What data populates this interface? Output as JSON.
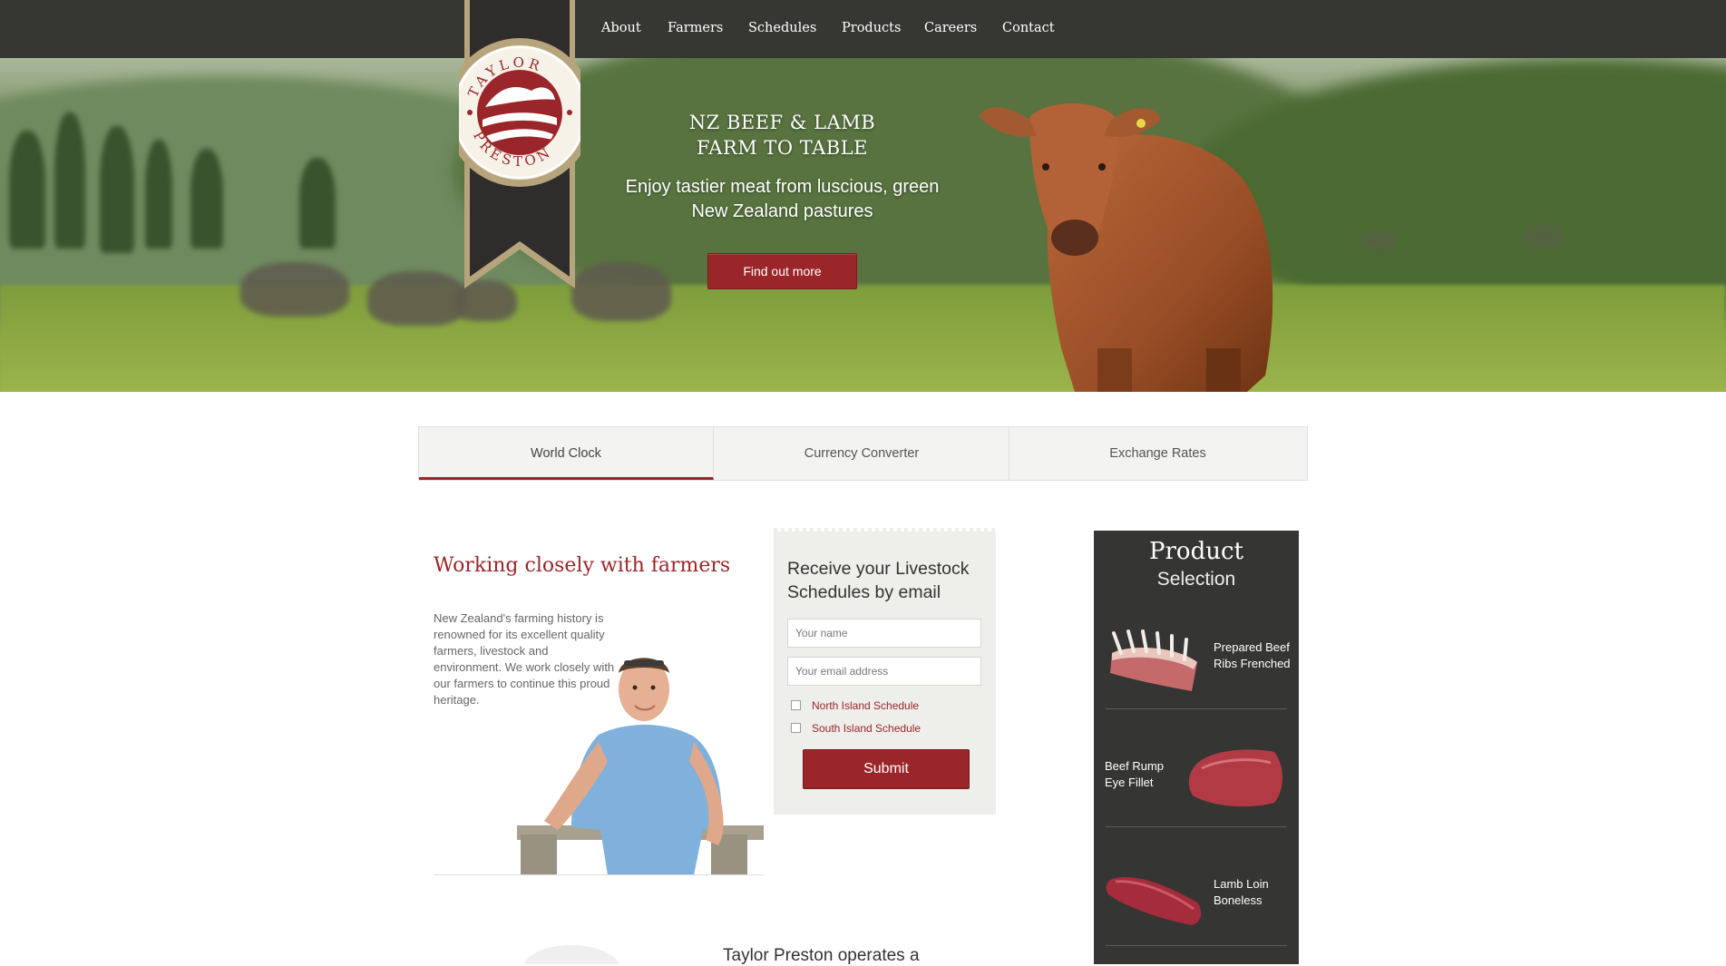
{
  "nav": {
    "items": [
      "About",
      "Farmers",
      "Schedules",
      "Products",
      "Careers",
      "Contact"
    ]
  },
  "logo": {
    "brand_text": "TAYLOR PRESTON"
  },
  "hero": {
    "title_line1": "NZ BEEF & LAMB",
    "title_line2": "FARM TO TABLE",
    "subtitle_line1": "Enjoy tastier meat from luscious, green",
    "subtitle_line2": "New Zealand pastures",
    "cta_label": "Find out more"
  },
  "tabs": {
    "items": [
      {
        "label": "World Clock",
        "active": true
      },
      {
        "label": "Currency Converter",
        "active": false
      },
      {
        "label": "Exchange Rates",
        "active": false
      }
    ]
  },
  "farmers": {
    "title": "Working closely with farmers",
    "body": "New Zealand's farming history is renowned for its excellent quality  farmers, livestock and environment. We work closely with our farmers to continue this proud heritage."
  },
  "signup": {
    "title": "Receive your Livestock Schedules by email",
    "name_placeholder": "Your name",
    "email_placeholder": "Your email address",
    "options": [
      "North Island Schedule",
      "South Island Schedule"
    ],
    "submit_label": "Submit"
  },
  "products": {
    "heading": "Product",
    "subheading": "Selection",
    "items": [
      {
        "name": "Prepared Beef Ribs Frenched"
      },
      {
        "name": "Beef Rump Eye Fillet"
      },
      {
        "name": "Lamb Loin Boneless"
      }
    ]
  },
  "bottom": {
    "text": "Taylor Preston operates a"
  },
  "colors": {
    "nav_bg": "#363633",
    "accent": "#9b262a",
    "sidebar_bg": "#353533"
  }
}
